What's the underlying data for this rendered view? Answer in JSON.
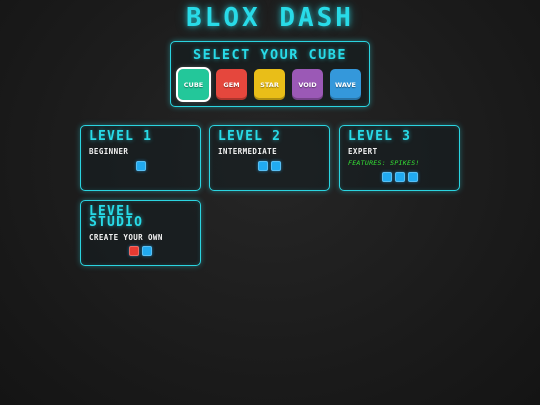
{
  "game": {
    "title": "BLOX DASH"
  },
  "cube_select": {
    "title": "SELECT YOUR CUBE",
    "cubes": [
      {
        "label": "CUBE",
        "color": "#23c79a",
        "selected": true
      },
      {
        "label": "GEM",
        "color": "#e5473d",
        "selected": false
      },
      {
        "label": "STAR",
        "color": "#e9be18",
        "selected": false
      },
      {
        "label": "VOID",
        "color": "#9b59b6",
        "selected": false
      },
      {
        "label": "WAVE",
        "color": "#3498db",
        "selected": false
      }
    ]
  },
  "levels": [
    {
      "name": "LEVEL 1",
      "subtitle": "BEGINNER",
      "features": "",
      "dots": [
        "#21aaf0"
      ]
    },
    {
      "name": "LEVEL 2",
      "subtitle": "INTERMEDIATE",
      "features": "",
      "dots": [
        "#21aaf0",
        "#21aaf0"
      ]
    },
    {
      "name": "LEVEL 3",
      "subtitle": "EXPERT",
      "features": "FEATURES: SPIKES!",
      "dots": [
        "#21aaf0",
        "#21aaf0",
        "#21aaf0"
      ]
    },
    {
      "name": "LEVEL STUDIO",
      "subtitle": "CREATE YOUR OWN",
      "features": "",
      "dots": [
        "#e53a32",
        "#21aaf0"
      ]
    }
  ],
  "colors": {
    "accent": "#28dbe8",
    "feature_text": "#34e234"
  }
}
